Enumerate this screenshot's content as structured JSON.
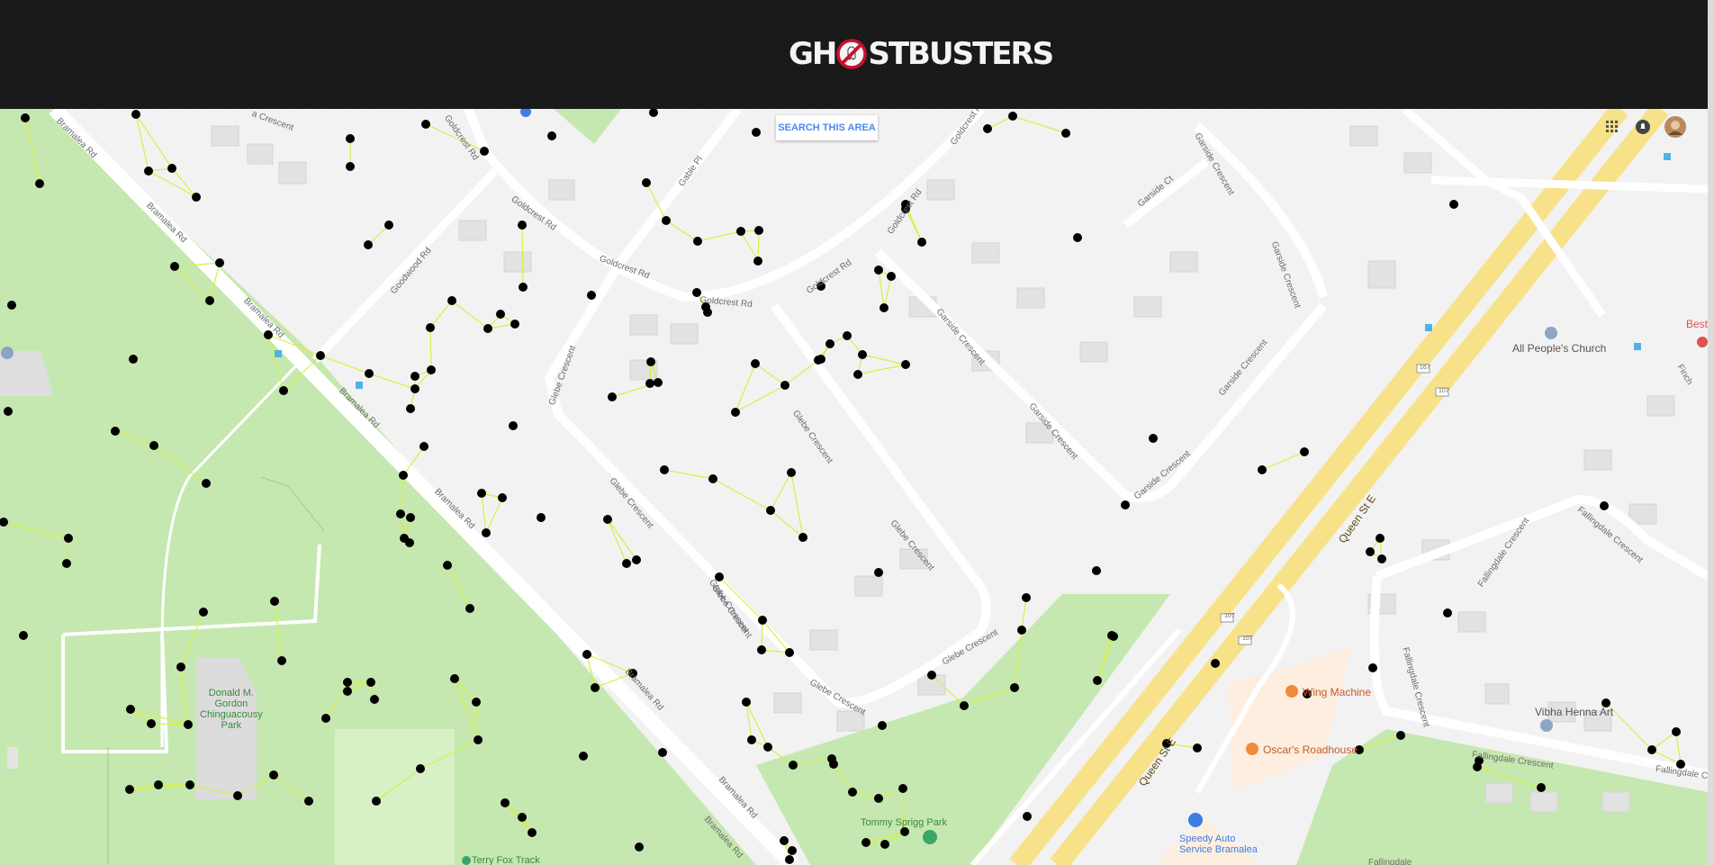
{
  "header": {
    "logo_left": "GH",
    "logo_right": "STBUSTERS"
  },
  "map": {
    "search_button": "SEARCH THIS AREA",
    "top_icons": [
      "apps-grid-icon",
      "notifications-icon",
      "user-avatar"
    ],
    "roads": [
      {
        "id": "bramalea1",
        "text": "Bramalea Rd"
      },
      {
        "id": "bramalea2",
        "text": "Bramalea Rd"
      },
      {
        "id": "bramalea3",
        "text": "Bramalea Rd"
      },
      {
        "id": "bramalea4",
        "text": "Bramalea Rd"
      },
      {
        "id": "bramalea5",
        "text": "Bramalea Rd"
      },
      {
        "id": "bramalea6",
        "text": "Bramalea Rd"
      },
      {
        "id": "bramalea7",
        "text": "Bramalea Rd"
      },
      {
        "id": "bramalea8",
        "text": "Bramalea Rd"
      },
      {
        "id": "goldcrest1",
        "text": "Goldcrest Rd"
      },
      {
        "id": "goldcrest2",
        "text": "Goldcrest Rd"
      },
      {
        "id": "goldcrest3",
        "text": "Goldcrest Rd"
      },
      {
        "id": "goldcrest4",
        "text": "Goldcrest Rd"
      },
      {
        "id": "goldcrest5",
        "text": "Goldcrest Rd"
      },
      {
        "id": "goldcrest6",
        "text": "Goldcrest Rd"
      },
      {
        "id": "goldcrest7",
        "text": "Goldcrest Rd"
      },
      {
        "id": "goodwood",
        "text": "Goodwood Rd"
      },
      {
        "id": "gablepl",
        "text": "Gable Pl"
      },
      {
        "id": "glebe1",
        "text": "Glebe Crescent"
      },
      {
        "id": "glebe2",
        "text": "Glebe Crescent"
      },
      {
        "id": "glebe3",
        "text": "Glebe Crescent"
      },
      {
        "id": "glebe4",
        "text": "Glebe Crescent"
      },
      {
        "id": "glebe5",
        "text": "Glebe Crescent"
      },
      {
        "id": "glebe6",
        "text": "Glebe Crescent"
      },
      {
        "id": "glebe7",
        "text": "Glebe Crescent"
      },
      {
        "id": "glebe8",
        "text": "Glebe Crescent"
      },
      {
        "id": "garside1",
        "text": "Garside Crescent"
      },
      {
        "id": "garside2",
        "text": "Garside Crescent"
      },
      {
        "id": "garside3",
        "text": "Garside Crescent"
      },
      {
        "id": "garside4",
        "text": "Garside Crescent"
      },
      {
        "id": "garside5",
        "text": "Garside Crescent"
      },
      {
        "id": "garside6",
        "text": "Garside Crescent"
      },
      {
        "id": "garsidect",
        "text": "Garside Ct"
      },
      {
        "id": "queen1",
        "text": "Queen St E"
      },
      {
        "id": "queen2",
        "text": "Queen St E"
      },
      {
        "id": "fallingdale1",
        "text": "Fallingdale Crescent"
      },
      {
        "id": "fallingdale2",
        "text": "Fallingdale Crescent"
      },
      {
        "id": "fallingdale3",
        "text": "Fallingdale Crescent"
      },
      {
        "id": "fallingdale4",
        "text": "Fallingdale Crescent"
      },
      {
        "id": "fallingdale5",
        "text": "Fallingdale Cr"
      },
      {
        "id": "fallingdale6",
        "text": "Fallingdale"
      },
      {
        "id": "finch",
        "text": "Finch"
      },
      {
        "id": "crescent",
        "text": "a Crescent"
      },
      {
        "id": "hwy1",
        "text": "107"
      },
      {
        "id": "hwy2",
        "text": "107"
      },
      {
        "id": "hwy3",
        "text": "167"
      },
      {
        "id": "hwy4",
        "text": "107"
      },
      {
        "id": "hwy5",
        "text": "107"
      }
    ],
    "places": [
      {
        "id": "park1",
        "text": "Donald M.\nGordon\nChinguacousy\nPark"
      },
      {
        "id": "park2",
        "text": "Tommy Sprigg Park"
      },
      {
        "id": "park3",
        "text": "Terry Fox Track"
      },
      {
        "id": "church",
        "text": "All People's Church"
      },
      {
        "id": "wing",
        "text": "Wing Machine"
      },
      {
        "id": "oscar",
        "text": "Oscar's Roadhouse"
      },
      {
        "id": "vibha",
        "text": "Vibha Henna Art"
      },
      {
        "id": "speedy",
        "text": "Speedy Auto\nService Bramalea"
      },
      {
        "id": "best",
        "text": "Best"
      }
    ]
  }
}
